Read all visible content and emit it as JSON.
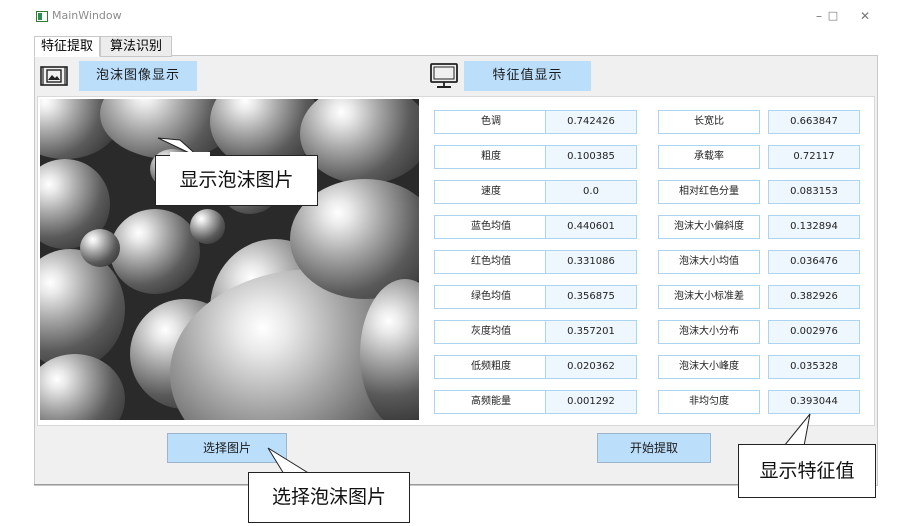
{
  "window": {
    "title": "MainWindow",
    "minimize_glyph": "–",
    "maximize_glyph": "□",
    "close_glyph": "✕"
  },
  "tabs": [
    {
      "label": "特征提取",
      "active": true
    },
    {
      "label": "算法识别",
      "active": false
    }
  ],
  "image_panel": {
    "icon": "image-frame-icon",
    "title": "泡沫图像显示"
  },
  "feature_panel": {
    "icon": "monitor-icon",
    "title": "特征值显示",
    "rows": [
      {
        "left_label": "色调",
        "left_value": "0.742426",
        "right_label": "长宽比",
        "right_value": "0.663847"
      },
      {
        "left_label": "粗度",
        "left_value": "0.100385",
        "right_label": "承载率",
        "right_value": "0.72117"
      },
      {
        "left_label": "速度",
        "left_value": "0.0",
        "right_label": "相对红色分量",
        "right_value": "0.083153"
      },
      {
        "left_label": "蓝色均值",
        "left_value": "0.440601",
        "right_label": "泡沫大小偏斜度",
        "right_value": "0.132894"
      },
      {
        "left_label": "红色均值",
        "left_value": "0.331086",
        "right_label": "泡沫大小均值",
        "right_value": "0.036476"
      },
      {
        "left_label": "绿色均值",
        "left_value": "0.356875",
        "right_label": "泡沫大小标准差",
        "right_value": "0.382926"
      },
      {
        "left_label": "灰度均值",
        "left_value": "0.357201",
        "right_label": "泡沫大小分布",
        "right_value": "0.002976"
      },
      {
        "left_label": "低频粗度",
        "left_value": "0.020362",
        "right_label": "泡沫大小峰度",
        "right_value": "0.035328"
      },
      {
        "left_label": "高频能量",
        "left_value": "0.001292",
        "right_label": "非均匀度",
        "right_value": "0.393044"
      }
    ]
  },
  "buttons": {
    "select_image": "选择图片",
    "start_extract": "开始提取"
  },
  "annotations": {
    "show_image": "显示泡沫图片",
    "select_image": "选择泡沫图片",
    "show_features": "显示特征值"
  },
  "colors": {
    "badge_bg": "#bbdefb",
    "field_border": "#abd4f0",
    "value_bg": "#eef7fd",
    "panel_bg": "#f0f0f0"
  }
}
